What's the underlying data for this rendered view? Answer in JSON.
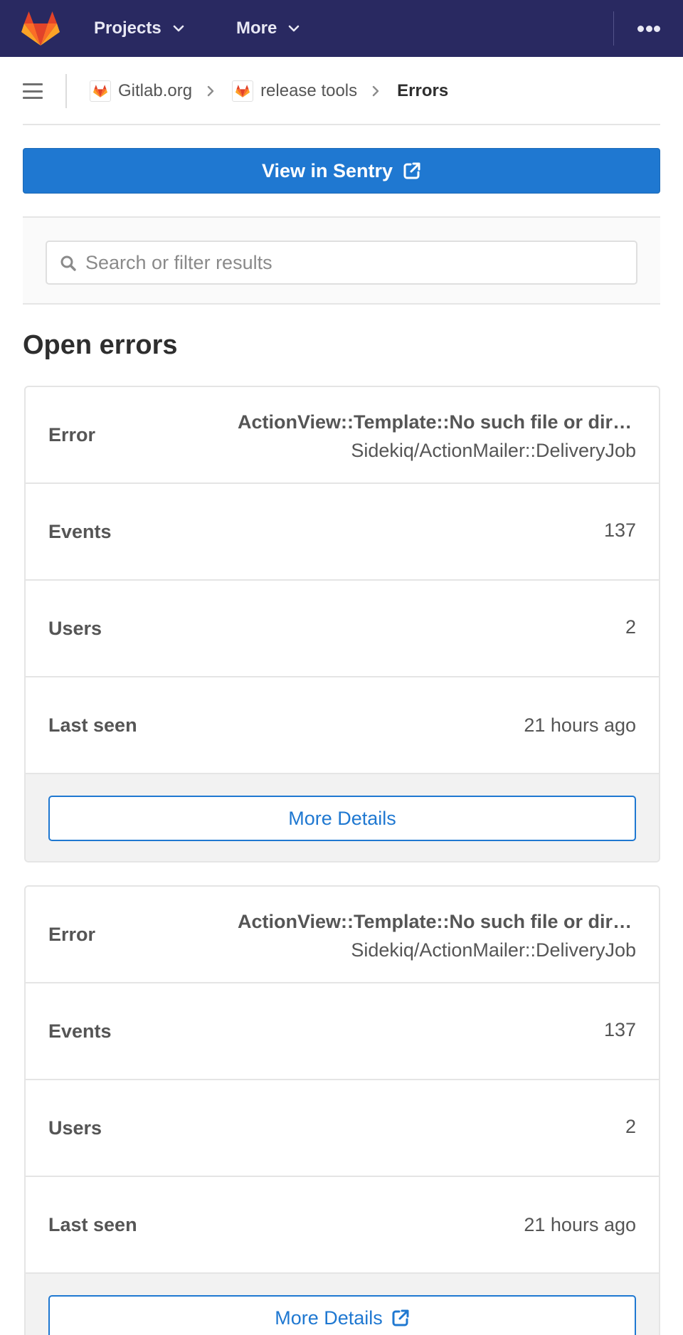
{
  "topnav": {
    "projects_label": "Projects",
    "more_label": "More"
  },
  "breadcrumb": {
    "group": "Gitlab.org",
    "project": "release tools",
    "current": "Errors"
  },
  "sentry_button_label": "View in Sentry",
  "search": {
    "placeholder": "Search or filter results",
    "value": ""
  },
  "section_title": "Open errors",
  "errors": [
    {
      "error_label": "Error",
      "error_title": "ActionView::Template::No such file or directory",
      "error_culprit": "Sidekiq/ActionMailer::DeliveryJob",
      "events_label": "Events",
      "events": "137",
      "users_label": "Users",
      "users": "2",
      "last_seen_label": "Last seen",
      "last_seen": "21 hours ago",
      "details_label": "More Details"
    },
    {
      "error_label": "Error",
      "error_title": "ActionView::Template::No such file or directory",
      "error_culprit": "Sidekiq/ActionMailer::DeliveryJob",
      "events_label": "Events",
      "events": "137",
      "users_label": "Users",
      "users": "2",
      "last_seen_label": "Last seen",
      "last_seen": "21 hours ago",
      "details_label": "More Details"
    }
  ],
  "colors": {
    "nav_bg": "#292961",
    "primary": "#1f78d1",
    "logo_orange": "#fc6d26",
    "logo_red": "#e24329",
    "logo_light": "#fca326"
  },
  "icons": [
    "gitlab-logo-icon",
    "chevron-down-icon",
    "ellipsis-icon",
    "hamburger-icon",
    "chevron-right-icon",
    "external-link-icon",
    "search-icon"
  ]
}
